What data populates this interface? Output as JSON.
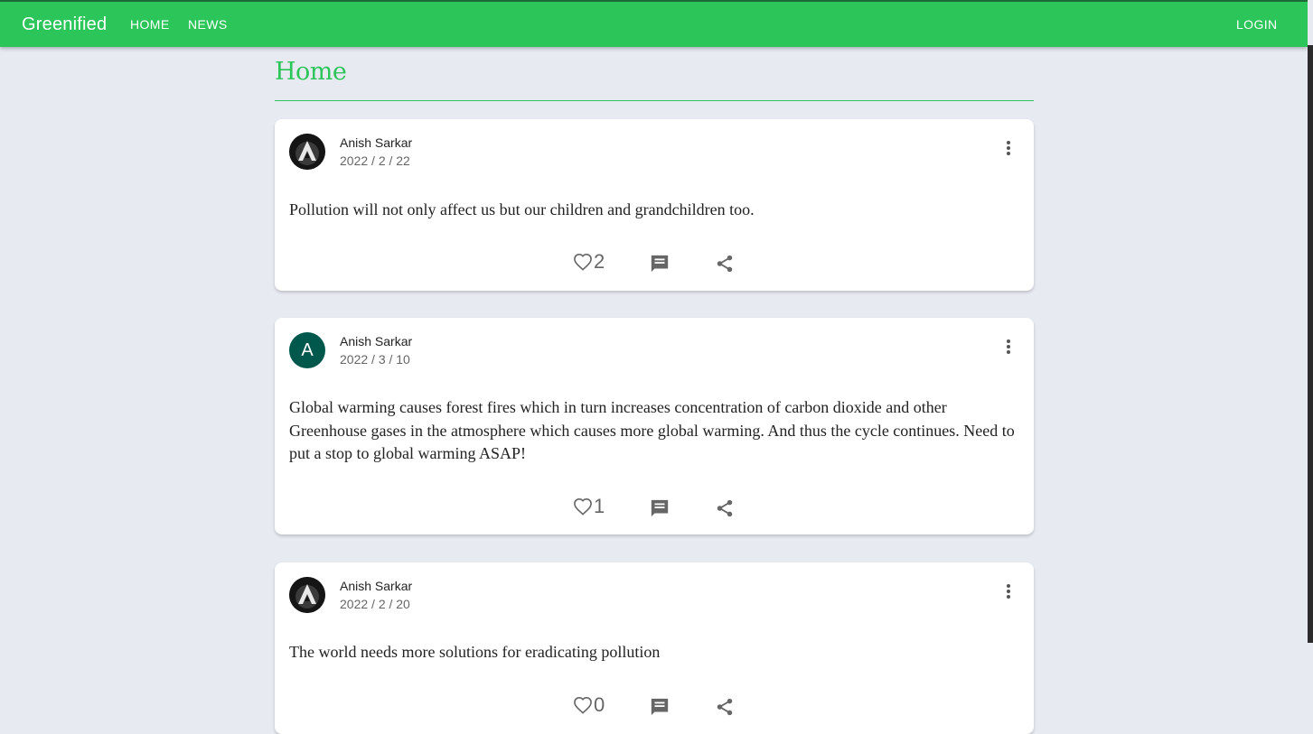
{
  "app": {
    "brand": "Greenified",
    "nav": [
      "HOME",
      "NEWS"
    ],
    "login": "LOGIN",
    "accent": "#2cc55a"
  },
  "page": {
    "title": "Home"
  },
  "posts": [
    {
      "author": "Anish Sarkar",
      "date": "2022 / 2 / 22",
      "avatar": "image",
      "text": "Pollution will not only affect us but our children and grandchildren too.",
      "likes": "2"
    },
    {
      "author": "Anish Sarkar",
      "date": "2022 / 3 / 10",
      "avatar": "letter",
      "avatar_letter": "A",
      "avatar_color": "#00574b",
      "text": "Global warming causes forest fires which in turn increases concentration of carbon dioxide and other Greenhouse gases in the atmosphere which causes more global warming. And thus the cycle continues. Need to put a stop to global warming ASAP!",
      "likes": "1"
    },
    {
      "author": "Anish Sarkar",
      "date": "2022 / 2 / 20",
      "avatar": "image",
      "text": "The world needs more solutions for eradicating pollution",
      "likes": "0"
    }
  ],
  "icons": {
    "like": "heart-outline-icon",
    "comment": "comment-icon",
    "share": "share-icon",
    "more": "more-vertical-icon"
  }
}
